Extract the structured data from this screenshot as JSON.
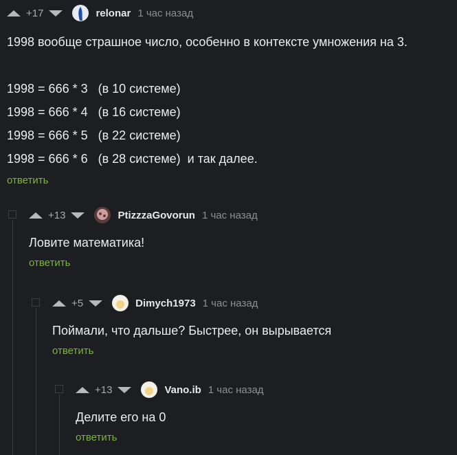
{
  "comments": [
    {
      "rating": "+17",
      "user": "relonar",
      "time": "1 час назад",
      "lines": [
        "1998 вообще страшное число, особенно в контексте умножения на 3.",
        "",
        "1998 = 666 * 3   (в 10 системе)",
        "1998 = 666 * 4   (в 16 системе)",
        "1998 = 666 * 5   (в 22 системе)",
        "1998 = 666 * 6   (в 28 системе)  и так далее."
      ],
      "reply": "ответить"
    },
    {
      "rating": "+13",
      "user": "PtizzzaGovorun",
      "time": "1 час назад",
      "lines": [
        "Ловите математика!"
      ],
      "reply": "ответить"
    },
    {
      "rating": "+5",
      "user": "Dimych1973",
      "time": "1 час назад",
      "lines": [
        "Поймали, что дальше? Быстрее, он вырывается"
      ],
      "reply": "ответить"
    },
    {
      "rating": "+13",
      "user": "Vano.ib",
      "time": "1 час назад",
      "lines": [
        "Делите его на 0"
      ],
      "reply": "ответить"
    }
  ],
  "icons": {
    "vote_up": "triangle-up-icon",
    "vote_down": "triangle-down-icon"
  },
  "colors": {
    "background": "#1d1e21",
    "reply_link": "#7cb342"
  }
}
